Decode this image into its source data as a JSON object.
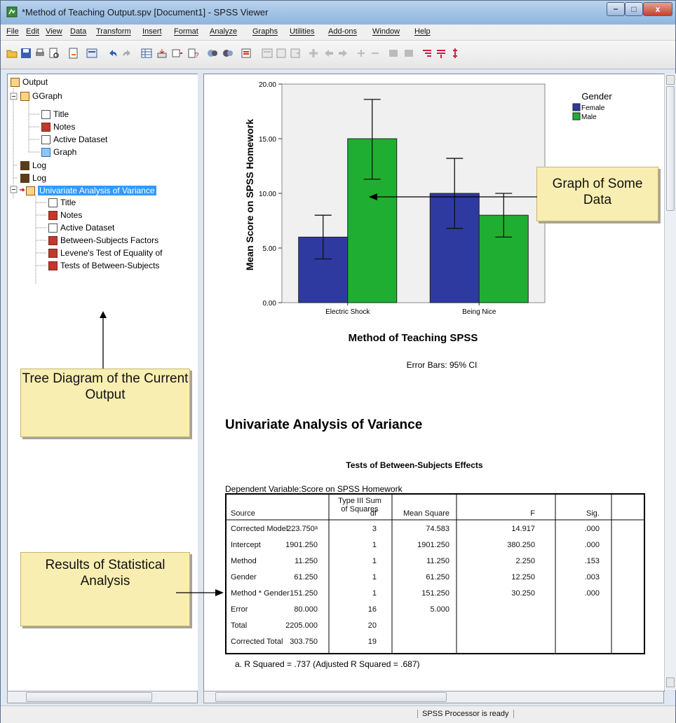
{
  "window": {
    "title": "*Method of Teaching Output.spv [Document1] - SPSS Viewer",
    "minimize": "−",
    "maximize": "□",
    "close": "x"
  },
  "menubar": [
    "File",
    "Edit",
    "View",
    "Data",
    "Transform",
    "Insert",
    "Format",
    "Analyze",
    "Graphs",
    "Utilities",
    "Add-ons",
    "Window",
    "Help"
  ],
  "tree": {
    "root": "Output",
    "ggraph": "GGraph",
    "ggraph_children": [
      "Title",
      "Notes",
      "Active Dataset",
      "Graph"
    ],
    "log1": "Log",
    "log2": "Log",
    "univariate": "Univariate Analysis of Variance",
    "univariate_children": [
      "Title",
      "Notes",
      "Active Dataset",
      "Between-Subjects Factors",
      "Levene's Test of Equality of",
      "Tests of Between-Subjects"
    ]
  },
  "callouts": {
    "tree": "Tree Diagram of the Current Output",
    "graph": "Graph of Some Data",
    "results": "Results of Statistical Analysis"
  },
  "chart_data": {
    "type": "bar",
    "categories": [
      "Electric Shock",
      "Being Nice"
    ],
    "series": [
      {
        "name": "Female",
        "values": [
          6.0,
          10.0
        ],
        "ci_low": [
          4.0,
          6.8
        ],
        "ci_high": [
          8.0,
          13.2
        ],
        "color": "#2e3aa0"
      },
      {
        "name": "Male",
        "values": [
          15.0,
          8.0
        ],
        "ci_low": [
          11.3,
          6.0
        ],
        "ci_high": [
          18.6,
          10.0
        ],
        "color": "#1fae32"
      }
    ],
    "xlabel": "Method of Teaching SPSS",
    "ylabel": "Mean Score on SPSS Homework",
    "ylim": [
      0,
      20
    ],
    "yticks": [
      "0.00",
      "5.00",
      "10.00",
      "15.00",
      "20.00"
    ],
    "legend_title": "Gender",
    "legend_position": "top-right",
    "footnote": "Error Bars: 95% CI"
  },
  "output": {
    "heading": "Univariate Analysis of Variance",
    "table_title": "Tests of Between-Subjects Effects",
    "dependent": "Dependent Variable:Score on SPSS Homework",
    "columns": [
      "Source",
      "Type III Sum\nof Squares",
      "df",
      "Mean Square",
      "F",
      "Sig."
    ],
    "rows": [
      [
        "Corrected Model",
        "223.750ᵃ",
        "3",
        "74.583",
        "14.917",
        ".000"
      ],
      [
        "Intercept",
        "1901.250",
        "1",
        "1901.250",
        "380.250",
        ".000"
      ],
      [
        "Method",
        "11.250",
        "1",
        "11.250",
        "2.250",
        ".153"
      ],
      [
        "Gender",
        "61.250",
        "1",
        "61.250",
        "12.250",
        ".003"
      ],
      [
        "Method * Gender",
        "151.250",
        "1",
        "151.250",
        "30.250",
        ".000"
      ],
      [
        "Error",
        "80.000",
        "16",
        "5.000",
        "",
        ""
      ],
      [
        "Total",
        "2205.000",
        "20",
        "",
        "",
        ""
      ],
      [
        "Corrected Total",
        "303.750",
        "19",
        "",
        "",
        ""
      ]
    ],
    "footnote": "a. R Squared = .737 (Adjusted R Squared = .687)"
  },
  "status": "SPSS  Processor is ready"
}
